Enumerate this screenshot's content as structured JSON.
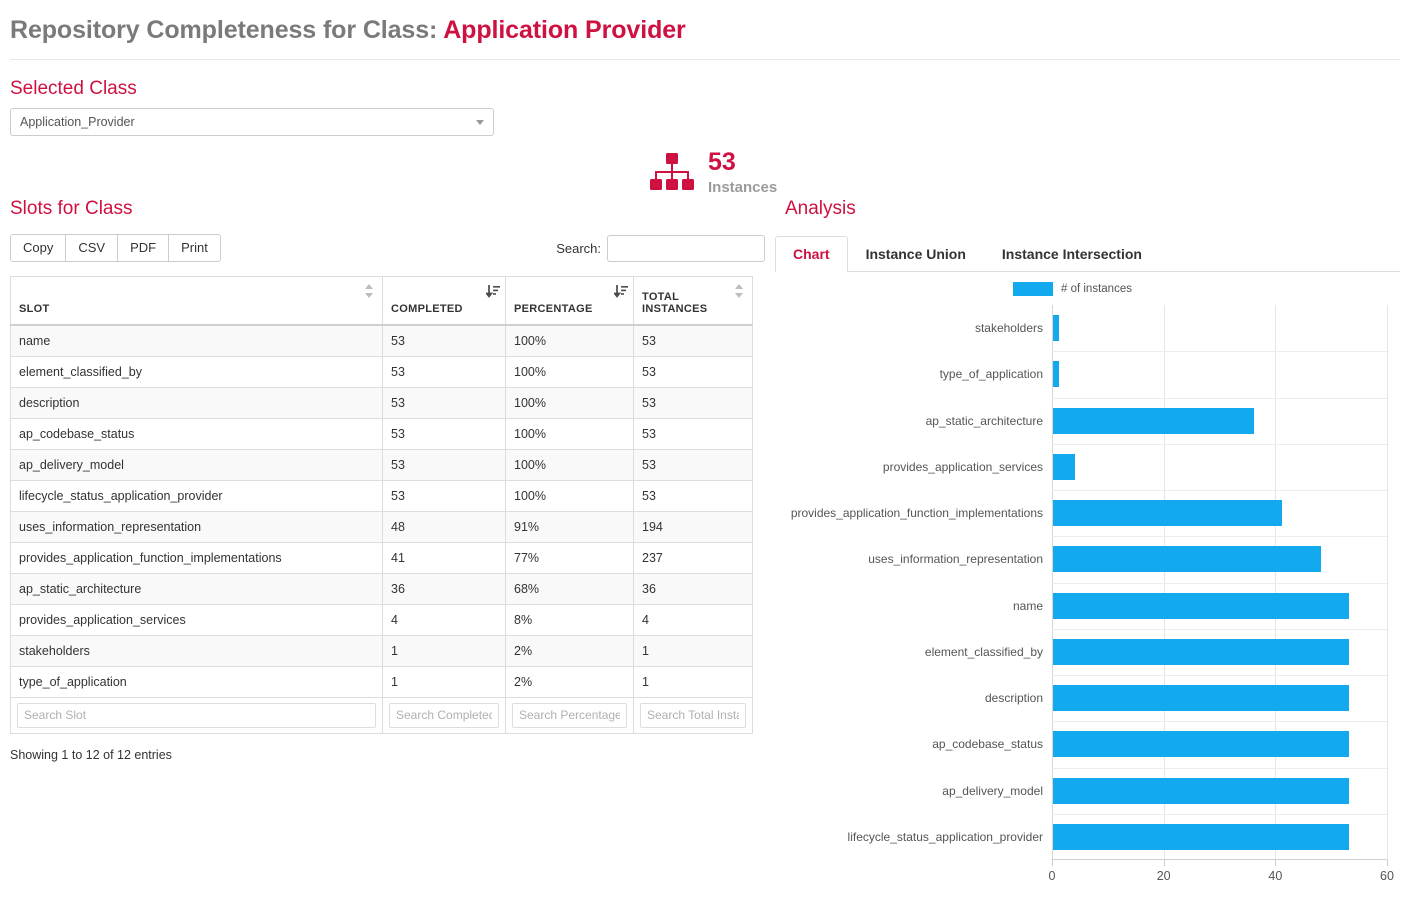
{
  "header": {
    "title_prefix": "Repository Completeness for Class: ",
    "title_class": "Application Provider"
  },
  "selected_class": {
    "heading": "Selected Class",
    "value": "Application_Provider"
  },
  "stat": {
    "icon": "sitemap-icon",
    "count": "53",
    "label": "Instances"
  },
  "slots_panel": {
    "heading": "Slots for Class",
    "buttons": [
      "Copy",
      "CSV",
      "PDF",
      "Print"
    ],
    "search_label": "Search:",
    "search_value": "",
    "search_placeholder": "",
    "columns": [
      "SLOT",
      "COMPLETED",
      "PERCENTAGE",
      "TOTAL INSTANCES"
    ],
    "column_sort_state": [
      "sortable",
      "desc",
      "desc",
      "sortable"
    ],
    "rows": [
      {
        "slot": "name",
        "completed": "53",
        "percentage": "100%",
        "total": "53"
      },
      {
        "slot": "element_classified_by",
        "completed": "53",
        "percentage": "100%",
        "total": "53"
      },
      {
        "slot": "description",
        "completed": "53",
        "percentage": "100%",
        "total": "53"
      },
      {
        "slot": "ap_codebase_status",
        "completed": "53",
        "percentage": "100%",
        "total": "53"
      },
      {
        "slot": "ap_delivery_model",
        "completed": "53",
        "percentage": "100%",
        "total": "53"
      },
      {
        "slot": "lifecycle_status_application_provider",
        "completed": "53",
        "percentage": "100%",
        "total": "53"
      },
      {
        "slot": "uses_information_representation",
        "completed": "48",
        "percentage": "91%",
        "total": "194"
      },
      {
        "slot": "provides_application_function_implementations",
        "completed": "41",
        "percentage": "77%",
        "total": "237"
      },
      {
        "slot": "ap_static_architecture",
        "completed": "36",
        "percentage": "68%",
        "total": "36"
      },
      {
        "slot": "provides_application_services",
        "completed": "4",
        "percentage": "8%",
        "total": "4"
      },
      {
        "slot": "stakeholders",
        "completed": "1",
        "percentage": "2%",
        "total": "1"
      },
      {
        "slot": "type_of_application",
        "completed": "1",
        "percentage": "2%",
        "total": "1"
      }
    ],
    "footer_placeholders": [
      "Search Slot",
      "Search Completed",
      "Search Percentage",
      "Search Total Instances"
    ],
    "info": "Showing 1 to 12 of 12 entries"
  },
  "analysis": {
    "heading": "Analysis",
    "tabs": [
      {
        "label": "Chart",
        "active": true
      },
      {
        "label": "Instance Union",
        "active": false
      },
      {
        "label": "Instance Intersection",
        "active": false
      }
    ]
  },
  "colors": {
    "accent_red": "#ce1141",
    "bar_blue": "#13a9ef",
    "title_gray": "#7a7a7a"
  },
  "chart_data": {
    "type": "bar",
    "orientation": "horizontal",
    "title": "",
    "xlabel": "",
    "ylabel": "",
    "legend": [
      "# of instances"
    ],
    "legend_position": "top",
    "grid": true,
    "xlim": [
      0,
      60
    ],
    "xticks": [
      0,
      20,
      40,
      60
    ],
    "categories": [
      "stakeholders",
      "type_of_application",
      "ap_static_architecture",
      "provides_application_services",
      "provides_application_function_implementations",
      "uses_information_representation",
      "name",
      "element_classified_by",
      "description",
      "ap_codebase_status",
      "ap_delivery_model",
      "lifecycle_status_application_provider"
    ],
    "values": [
      1,
      1,
      36,
      4,
      41,
      48,
      53,
      53,
      53,
      53,
      53,
      53
    ],
    "series": [
      {
        "name": "# of instances",
        "values": [
          1,
          1,
          36,
          4,
          41,
          48,
          53,
          53,
          53,
          53,
          53,
          53
        ]
      }
    ]
  }
}
